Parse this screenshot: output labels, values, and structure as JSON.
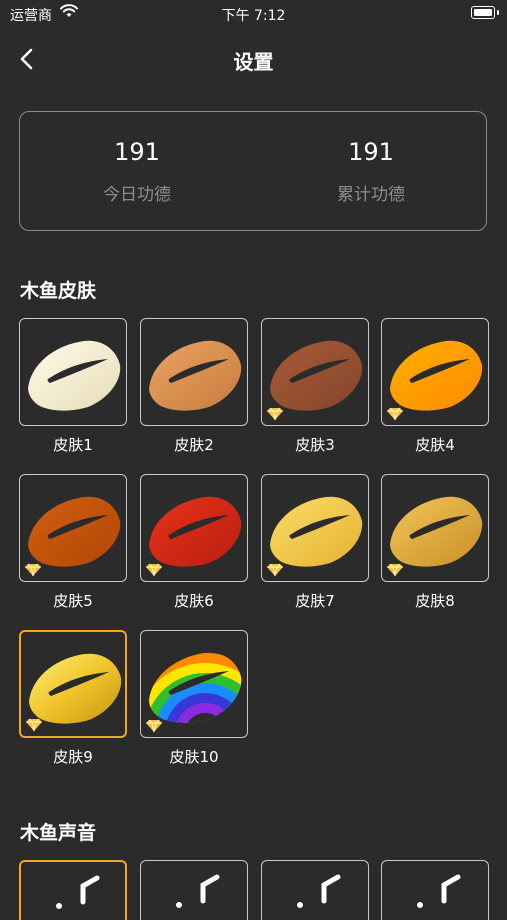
{
  "status_bar": {
    "carrier": "运营商",
    "time": "下午 7:12"
  },
  "nav": {
    "title": "设置"
  },
  "stats": {
    "today_value": "191",
    "today_label": "今日功德",
    "total_value": "191",
    "total_label": "累计功德"
  },
  "skins_section": {
    "title": "木鱼皮肤"
  },
  "skins": [
    {
      "label": "皮肤1",
      "premium": false,
      "selected": false
    },
    {
      "label": "皮肤2",
      "premium": false,
      "selected": false
    },
    {
      "label": "皮肤3",
      "premium": true,
      "selected": false
    },
    {
      "label": "皮肤4",
      "premium": true,
      "selected": false
    },
    {
      "label": "皮肤5",
      "premium": true,
      "selected": false
    },
    {
      "label": "皮肤6",
      "premium": true,
      "selected": false
    },
    {
      "label": "皮肤7",
      "premium": true,
      "selected": false
    },
    {
      "label": "皮肤8",
      "premium": true,
      "selected": false
    },
    {
      "label": "皮肤9",
      "premium": true,
      "selected": true
    },
    {
      "label": "皮肤10",
      "premium": true,
      "selected": false
    }
  ],
  "sound_section": {
    "title": "木鱼声音"
  },
  "colors": {
    "accent": "#f5a623",
    "skin1": "#f3ecd2",
    "skin2": "#d9904f",
    "skin3": "#9a5232",
    "skin4": "#ff9d00",
    "skin5": "#c4520a",
    "skin6": "#d42a14",
    "skin7": "#f0c640",
    "skin8": "#dda63a",
    "skin9": "#e9bf22"
  }
}
